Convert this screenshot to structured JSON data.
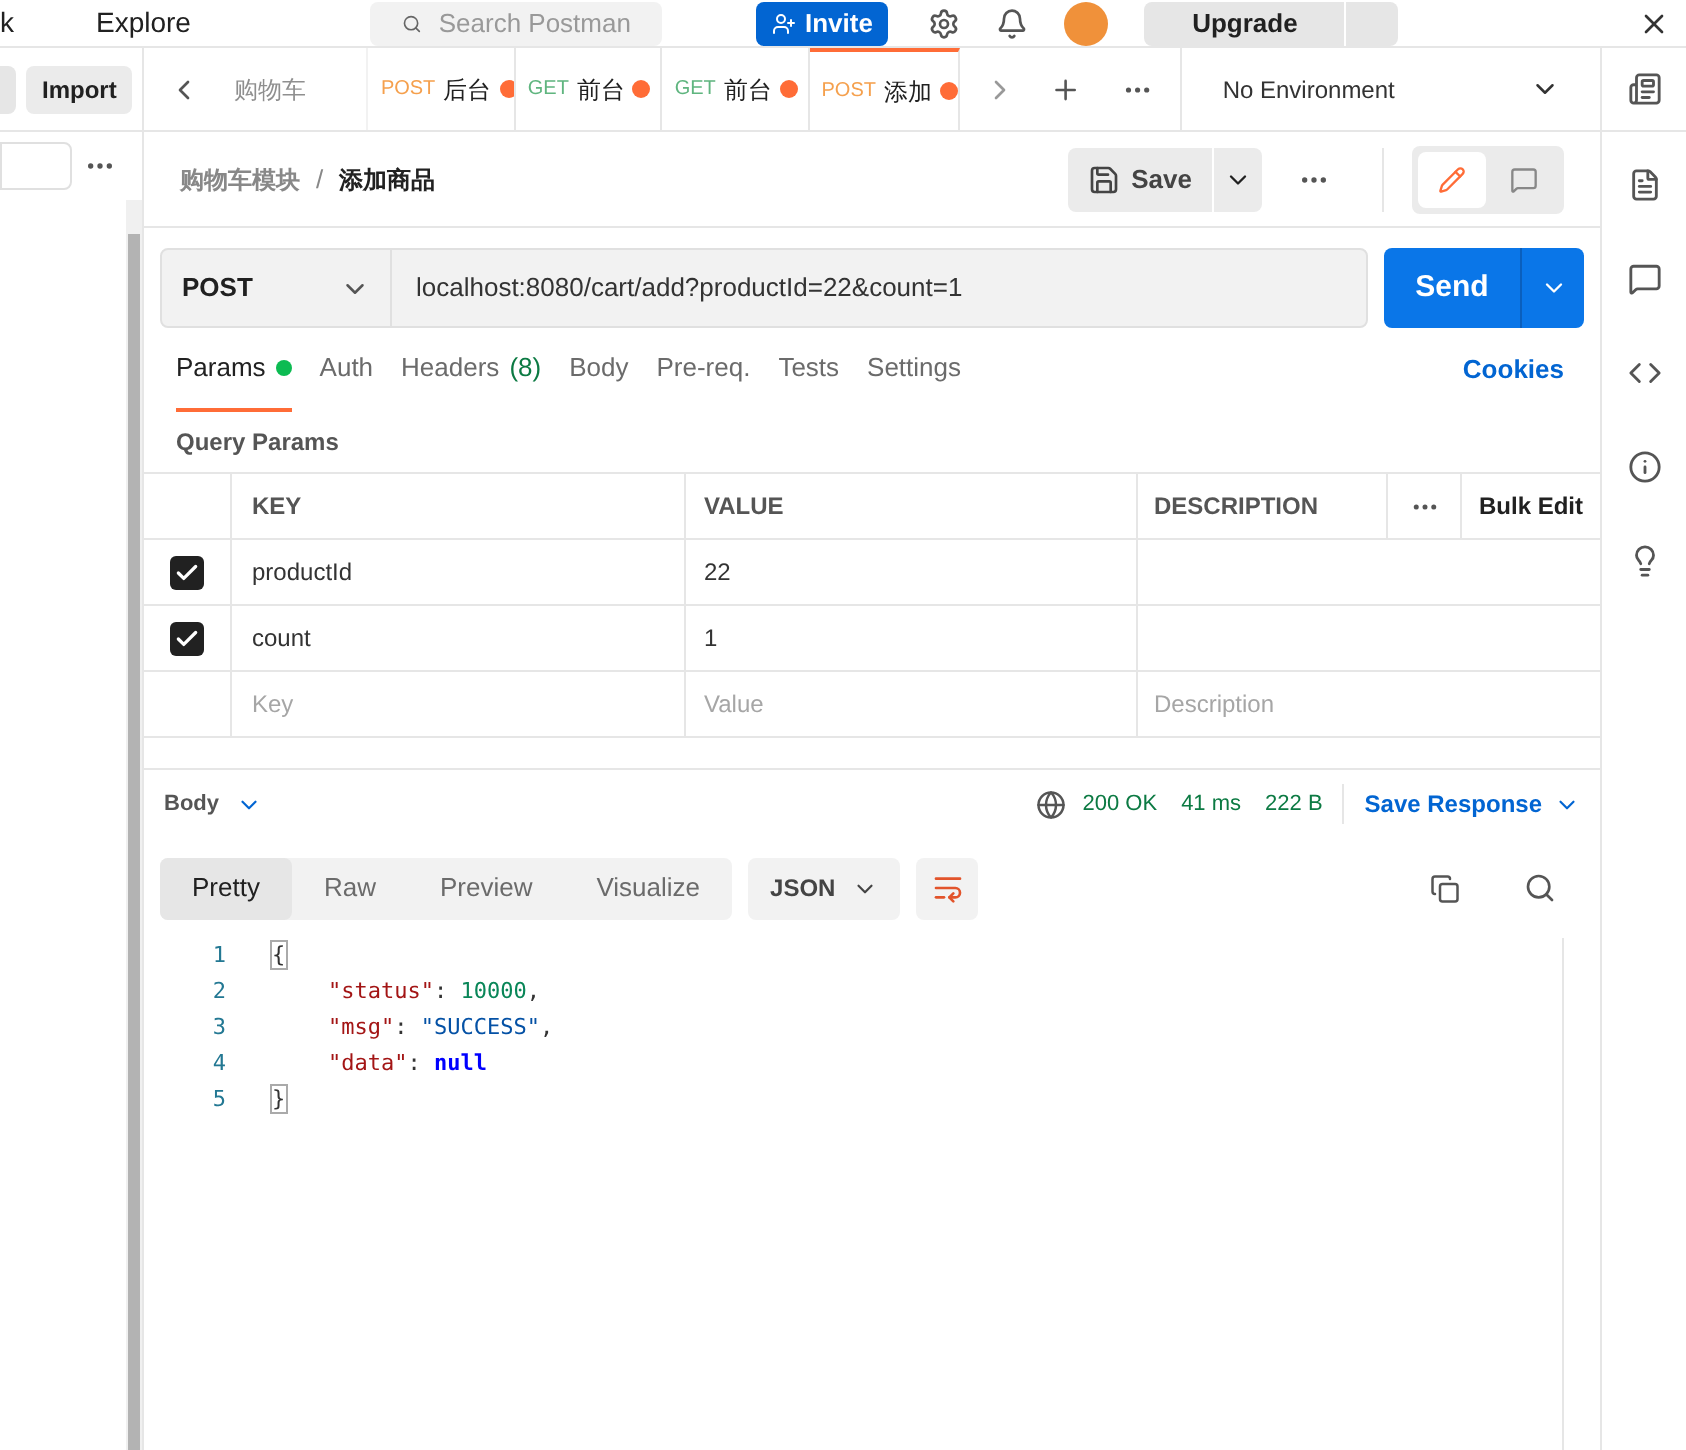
{
  "top_bar": {
    "nav_left": "k",
    "nav_explore": "Explore",
    "search": {
      "placeholder": "Search Postman"
    },
    "invite": "Invite",
    "upgrade": "Upgrade"
  },
  "sidebar": {
    "import_button": "Import"
  },
  "tabs": [
    {
      "title": "购物车",
      "selected": false,
      "dirty": false,
      "faded": true
    },
    {
      "method": "POST",
      "title": "后台",
      "selected": false,
      "dirty": true,
      "faded": false
    },
    {
      "method": "GET",
      "title": "前台",
      "selected": false,
      "dirty": true,
      "faded": false
    },
    {
      "method": "GET",
      "title": "前台",
      "selected": false,
      "dirty": true,
      "faded": false
    },
    {
      "method": "POST",
      "title": "添加",
      "selected": true,
      "dirty": true,
      "faded": false
    }
  ],
  "environment": "No Environment",
  "breadcrumb": {
    "parent": "购物车模块",
    "separator": "/",
    "current": "添加商品"
  },
  "save_button": "Save",
  "request": {
    "method": "POST",
    "url": "localhost:8080/cart/add?productId=22&count=1",
    "send": "Send"
  },
  "request_tabs": [
    {
      "label": "Params",
      "indicator": true,
      "selected": true
    },
    {
      "label": "Auth",
      "indicator": false,
      "selected": false
    },
    {
      "label": "Headers",
      "count": "(8)",
      "indicator": false,
      "selected": false
    },
    {
      "label": "Body",
      "indicator": false,
      "selected": false
    },
    {
      "label": "Pre-req.",
      "indicator": false,
      "selected": false
    },
    {
      "label": "Tests",
      "indicator": false,
      "selected": false
    },
    {
      "label": "Settings",
      "indicator": false,
      "selected": false
    }
  ],
  "cookies": "Cookies",
  "query_params": {
    "title": "Query Params",
    "columns": [
      "KEY",
      "VALUE",
      "DESCRIPTION"
    ],
    "bulk_edit": "Bulk Edit",
    "rows": [
      {
        "checked": true,
        "key": "productId",
        "value": "22"
      },
      {
        "checked": true,
        "key": "count",
        "value": "1"
      }
    ],
    "placeholder_row": {
      "key": {
        "placeholder": "Key"
      },
      "value": {
        "placeholder": "Value"
      },
      "description": {
        "placeholder": "Description"
      }
    }
  },
  "response": {
    "section": "Body",
    "status": "200 OK",
    "time": "41 ms",
    "size": "222 B",
    "save_response": "Save Response",
    "view_tabs": [
      {
        "label": "Pretty",
        "selected": true
      },
      {
        "label": "Raw",
        "selected": false
      },
      {
        "label": "Preview",
        "selected": false
      },
      {
        "label": "Visualize",
        "selected": false
      }
    ],
    "format": "JSON",
    "code": [
      {
        "number": "1",
        "indented": false,
        "tokens": [
          {
            "kind": "bracket",
            "text": "{"
          }
        ]
      },
      {
        "number": "2",
        "indented": true,
        "tokens": [
          {
            "kind": "key",
            "text": "\"status\""
          },
          {
            "kind": "punct",
            "text": ": "
          },
          {
            "kind": "number",
            "text": "10000"
          },
          {
            "kind": "punct",
            "text": ","
          }
        ]
      },
      {
        "number": "3",
        "indented": true,
        "tokens": [
          {
            "kind": "key",
            "text": "\"msg\""
          },
          {
            "kind": "punct",
            "text": ": "
          },
          {
            "kind": "string",
            "text": "\"SUCCESS\""
          },
          {
            "kind": "punct",
            "text": ","
          }
        ]
      },
      {
        "number": "4",
        "indented": true,
        "tokens": [
          {
            "kind": "key",
            "text": "\"data\""
          },
          {
            "kind": "punct",
            "text": ": "
          },
          {
            "kind": "keyword",
            "text": "null"
          }
        ]
      },
      {
        "number": "5",
        "indented": false,
        "tokens": [
          {
            "kind": "bracket",
            "text": "}"
          }
        ]
      }
    ]
  }
}
